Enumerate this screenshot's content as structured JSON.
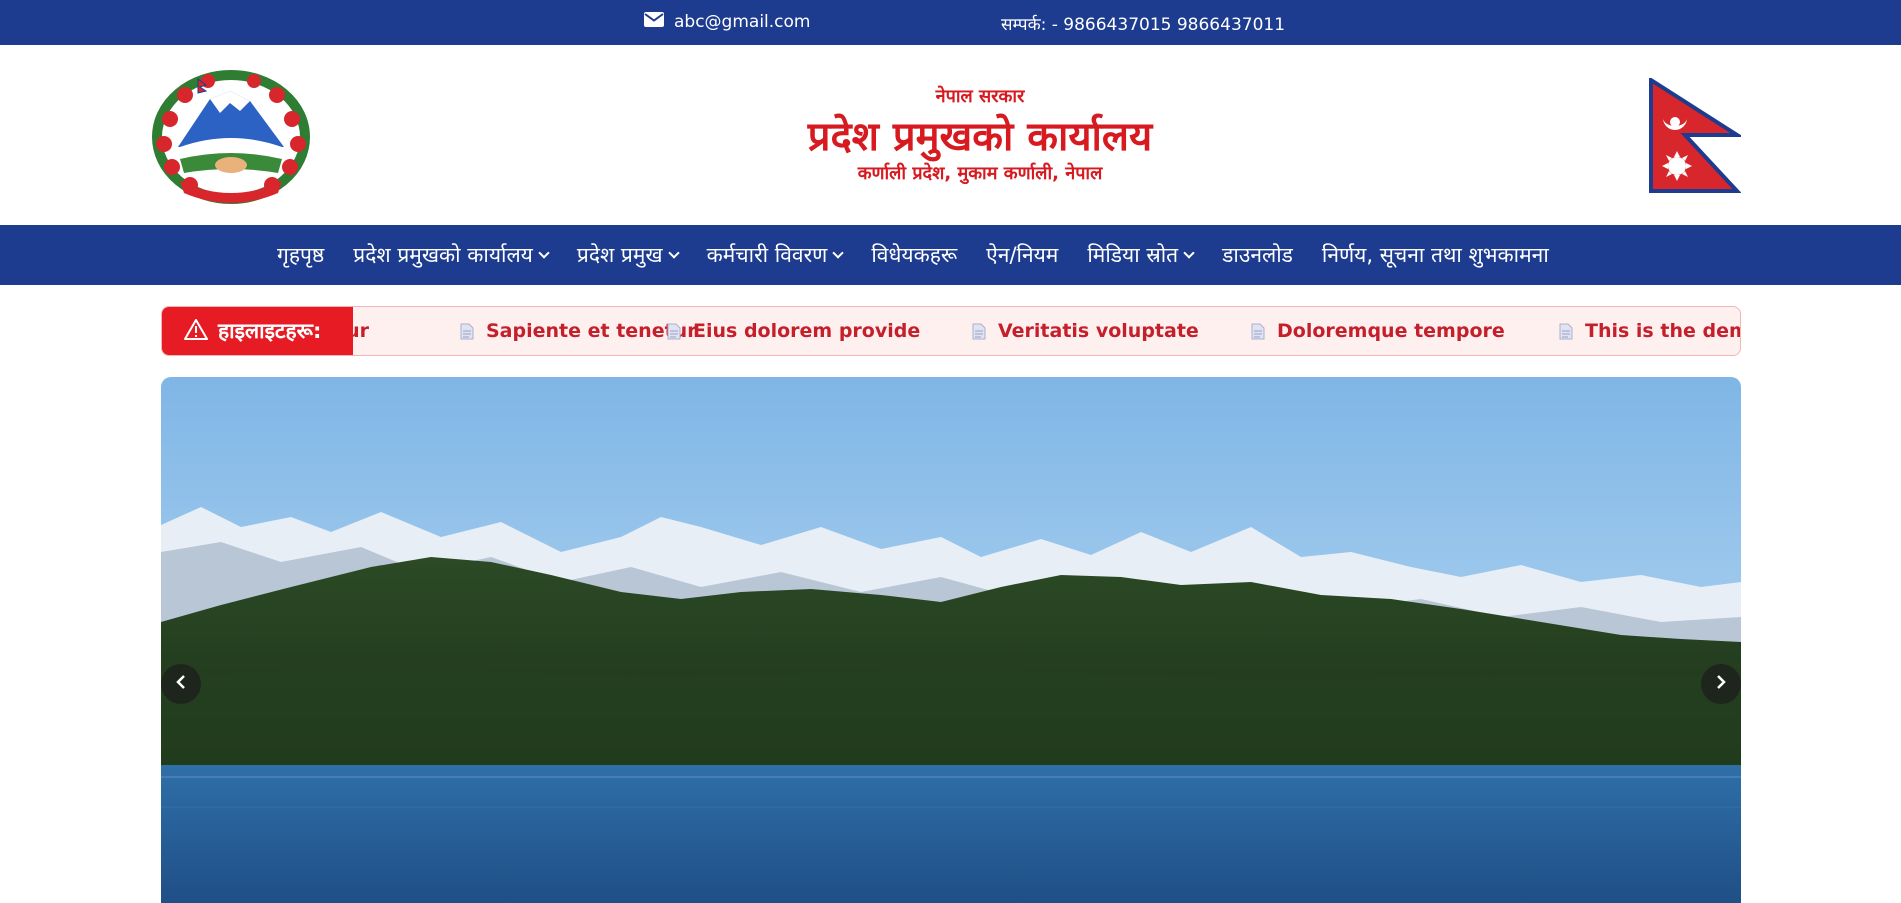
{
  "topbar": {
    "email": "abc@gmail.com",
    "phone": "सम्पर्क: - 9866437015 9866437011",
    "email_icon": "envelope-icon"
  },
  "header": {
    "gov_name": "नेपाल सरकार",
    "office_name": "प्रदेश प्रमुखको कार्यालय",
    "address": "कर्णाली प्रदेश, मुकाम कर्णाली, नेपाल",
    "emblem": "nepal-emblem",
    "flag": "nepal-flag"
  },
  "nav": {
    "items": [
      {
        "label": "गृहपृष्ठ",
        "dropdown": false
      },
      {
        "label": "प्रदेश प्रमुखको कार्यालय",
        "dropdown": true
      },
      {
        "label": "प्रदेश प्रमुख",
        "dropdown": true
      },
      {
        "label": "कर्मचारी विवरण",
        "dropdown": true
      },
      {
        "label": "विधेयकहरू",
        "dropdown": false
      },
      {
        "label": "ऐन/नियम",
        "dropdown": false
      },
      {
        "label": "मिडिया स्रोत",
        "dropdown": true
      },
      {
        "label": "डाउनलोड",
        "dropdown": false
      },
      {
        "label": "निर्णय, सूचना तथा शुभकामना",
        "dropdown": false
      }
    ]
  },
  "highlights": {
    "label": "हाइलाइटहरू:",
    "label_icon": "warning-triangle-icon",
    "items": [
      "tur",
      "Sapiente et tenetur",
      "Eius dolorem provide",
      "Veritatis voluptate",
      "Doloremque tempore",
      "This is the demo"
    ]
  },
  "slider": {
    "prev_icon": "chevron-left-icon",
    "next_icon": "chevron-right-icon",
    "image": "mountain-lake-landscape"
  },
  "colors": {
    "primary": "#1d3b8f",
    "accent_red": "#d71920",
    "ticker_bg": "#fff0f0"
  }
}
